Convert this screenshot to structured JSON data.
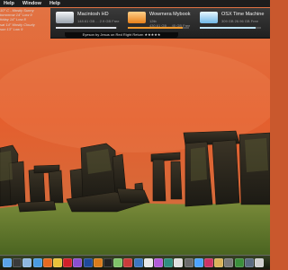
{
  "menubar": {
    "items": [
      "Help",
      "Window",
      "Help"
    ]
  },
  "weather": {
    "lines": [
      "10° C - Mostly Sunny",
      "tomorrow 14° Low 9",
      "friday 14° Low 8",
      "sat 14° Mostly Cloudy",
      "sun 13° Low 9"
    ]
  },
  "drives": [
    {
      "name": "Macintosh HD",
      "info": "148.61 GB ... 2.9 GB Free",
      "color": "#dfe3e8",
      "fill": 0.98
    },
    {
      "name": "Wowmera Mybook",
      "info": "12tb\n430.61 GB ... 45 GB Free",
      "color": "#f29a2e",
      "fill": 0.9
    },
    {
      "name": "OSX Time Machine",
      "info": "309 GB 26.96 GB Free",
      "color": "#bfe6ff",
      "fill": 0.91
    }
  ],
  "itunes": {
    "text": "Eyeson by Jesus on Red Right Return ★★★★★"
  },
  "dock": {
    "icons": [
      "finder-icon",
      "dashboard-icon",
      "mail-icon",
      "safari-icon",
      "firefox-icon",
      "chrome-icon",
      "opera-icon",
      "itunes-icon",
      "photoshop-icon",
      "illustrator-icon",
      "terminal-icon",
      "app-icon",
      "app-icon",
      "app-icon",
      "calendar-icon",
      "app-icon",
      "app-icon",
      "app-icon",
      "app-icon",
      "app-icon",
      "app-icon",
      "app-icon",
      "app-icon",
      "app-icon",
      "downloads-icon",
      "trash-icon"
    ],
    "colors": [
      "#5aa2e8",
      "#3a3a3a",
      "#8fb8e0",
      "#4a9be0",
      "#e66a22",
      "#e8c23a",
      "#d11f2a",
      "#8a4fd0",
      "#1f4a9a",
      "#d97b1b",
      "#222",
      "#7fc36a",
      "#c93b3b",
      "#3c76c0",
      "#e8e8e8",
      "#b15ad7",
      "#2f8f7f",
      "#e0e0e0",
      "#6b6b6b",
      "#4da3ff",
      "#cc3366",
      "#d9b25a",
      "#7a7a7a",
      "#3b8f3b",
      "#5a6b80",
      "#cfcfcf"
    ]
  },
  "colors": {
    "sky_top": "#e86a3a",
    "sky_mid": "#d85a2c",
    "grass": "#5f7a2a"
  }
}
